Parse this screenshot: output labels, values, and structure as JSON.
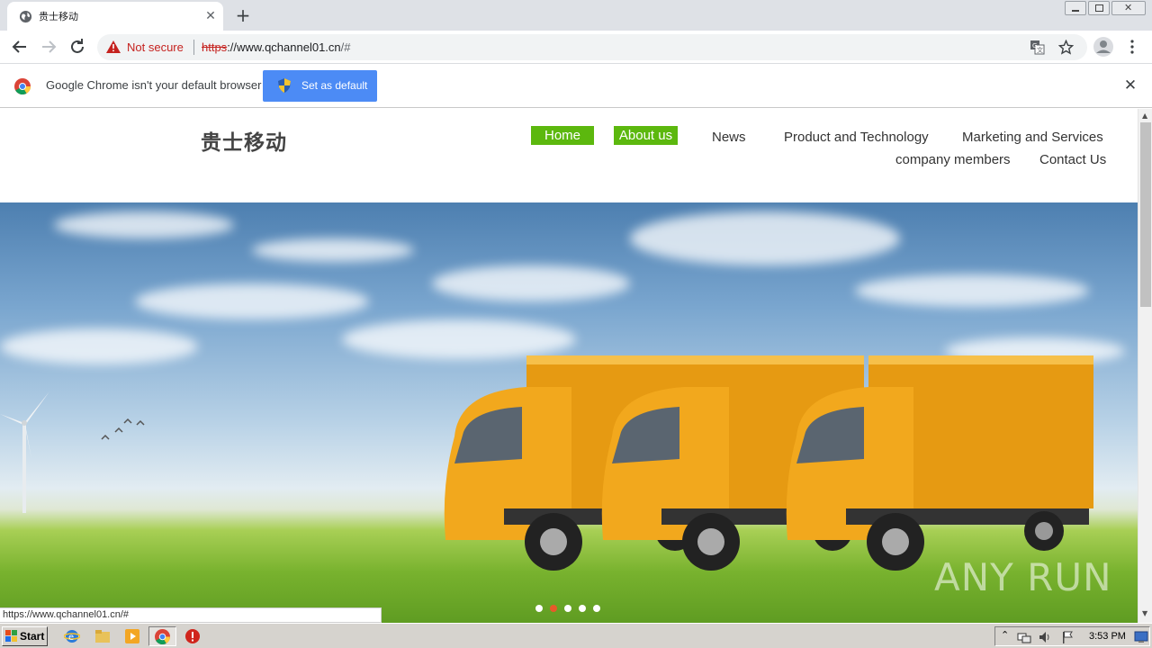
{
  "browser": {
    "tab_title": "贵士移动",
    "security_label": "Not secure",
    "url_scheme": "https",
    "url_host": "://www.qchannel01.cn",
    "url_path": "/#"
  },
  "infobar": {
    "message": "Google Chrome isn't your default browser",
    "button_label": "Set as default"
  },
  "site": {
    "logo_text": "贵士移动",
    "nav": [
      {
        "label": "Home",
        "active": true
      },
      {
        "label": "About us",
        "active": true
      },
      {
        "label": "News",
        "active": false
      },
      {
        "label": "Product and Technology",
        "active": false
      },
      {
        "label": "Marketing and Services",
        "active": false
      },
      {
        "label": "company members",
        "active": false
      },
      {
        "label": "Contact Us",
        "active": false
      }
    ],
    "slider": {
      "slide_count": 5,
      "current_slide": 2
    },
    "watermark": "ANY RUN"
  },
  "status_bar_url": "https://www.qchannel01.cn/#",
  "taskbar": {
    "start_label": "Start",
    "clock": "3:53 PM"
  },
  "colors": {
    "nav_active": "#5cb80e",
    "chrome_button": "#4c8bf5",
    "warning_red": "#c5221f",
    "truck_yellow": "#f2a81d"
  }
}
